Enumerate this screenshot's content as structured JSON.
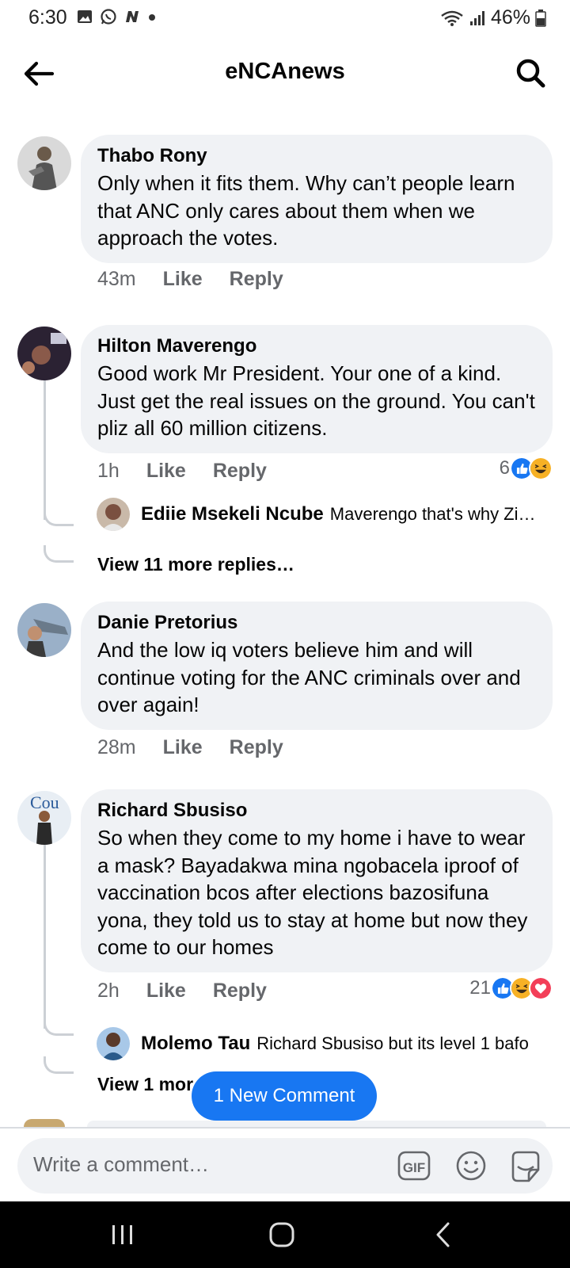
{
  "status_bar": {
    "time": "6:30",
    "battery": "46%",
    "left_icons": [
      "gallery-icon",
      "whatsapp-icon",
      "n-app-icon",
      "dot-icon"
    ],
    "right_icons": [
      "wifi-icon",
      "signal-icon",
      "battery-icon"
    ]
  },
  "header": {
    "title": "eNCAnews",
    "back_icon": "arrow-left-icon",
    "search_icon": "search-icon"
  },
  "comments": [
    {
      "author": "Thabo Rony",
      "text": "Only when it fits them. Why can’t people learn that ANC only cares about them when we approach the votes.",
      "time": "43m",
      "like_label": "Like",
      "reply_label": "Reply"
    },
    {
      "author": "Hilton Maverengo",
      "text": "Good work Mr President. Your one of a kind. Just get the real issues on the ground. You can't pliz all 60 million  citizens.",
      "time": "1h",
      "like_label": "Like",
      "reply_label": "Reply",
      "reaction_count": "6",
      "reactions": [
        "like-icon",
        "haha-icon"
      ],
      "reply_preview": {
        "author": "Ediie Msekeli Ncube",
        "text": "Maverengo that's why Zi…"
      },
      "view_more": "View 11 more replies…"
    },
    {
      "author": "Danie Pretorius",
      "text": "And the low iq voters believe him and will continue voting for the ANC criminals over and over again!",
      "time": "28m",
      "like_label": "Like",
      "reply_label": "Reply"
    },
    {
      "author": "Richard Sbusiso",
      "text": "So when they come to my home i have to wear a mask?  Bayadakwa mina ngobacela iproof of vaccination bcos after elections bazosifuna yona, they told us to stay at home but now they come to our homes",
      "time": "2h",
      "like_label": "Like",
      "reply_label": "Reply",
      "reaction_count": "21",
      "reactions": [
        "like-icon",
        "haha-icon",
        "love-icon"
      ],
      "reply_preview": {
        "author": "Molemo Tau",
        "text": "Richard Sbusiso but its level 1 bafo"
      },
      "view_more": "View 1 mor"
    }
  ],
  "new_comment_pill": "1 New Comment",
  "composer": {
    "placeholder": "Write a comment…",
    "gif_label": "GIF"
  },
  "nav_bar": {
    "icons": [
      "recents-icon",
      "home-icon",
      "back-icon"
    ]
  },
  "colors": {
    "accent": "#1877f2",
    "bubble": "#f0f2f5",
    "secondary_text": "#65676b",
    "love": "#f33e58",
    "haha": "#f7b125"
  }
}
